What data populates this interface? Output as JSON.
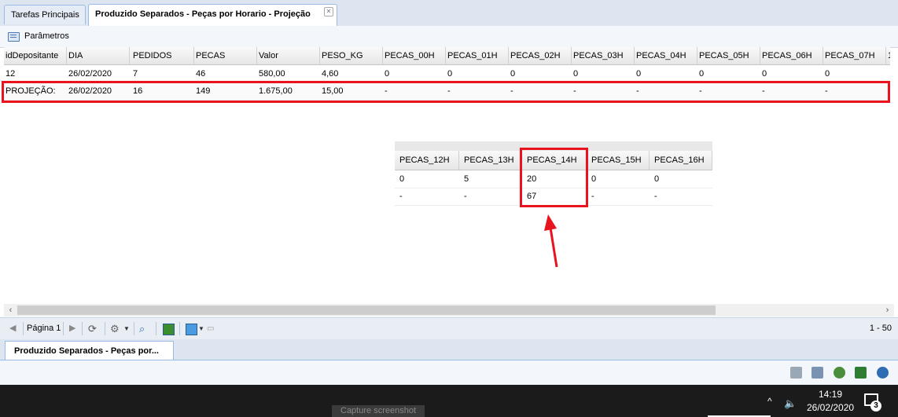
{
  "tabs": {
    "main": "Tarefas Principais",
    "active": "Produzido Separados - Peças por Horario - Projeção",
    "close_glyph": "✕"
  },
  "params": {
    "label": "Parâmetros"
  },
  "grid": {
    "columns": [
      "idDepositante",
      "DIA",
      "PEDIDOS",
      "PECAS",
      "Valor",
      "PESO_KG",
      "PECAS_00H",
      "PECAS_01H",
      "PECAS_02H",
      "PECAS_03H",
      "PECAS_04H",
      "PECAS_05H",
      "PECAS_06H",
      "PECAS_07H",
      "1"
    ],
    "rows": [
      [
        "12",
        "26/02/2020",
        "7",
        "46",
        "580,00",
        "4,60",
        "0",
        "0",
        "0",
        "0",
        "0",
        "0",
        "0",
        "0",
        ""
      ],
      [
        "PROJEÇÃO:",
        "26/02/2020",
        "16",
        "149",
        "1.675,00",
        "15,00",
        "-",
        "-",
        "-",
        "-",
        "-",
        "-",
        "-",
        "-",
        ""
      ]
    ]
  },
  "zoom_table": {
    "columns": [
      "PECAS_12H",
      "PECAS_13H",
      "PECAS_14H",
      "PECAS_15H",
      "PECAS_16H"
    ],
    "rows": [
      [
        "0",
        "5",
        "20",
        "0",
        "0"
      ],
      [
        "-",
        "-",
        "67",
        "-",
        "-"
      ]
    ]
  },
  "scroll": {
    "left": "‹",
    "right": "›"
  },
  "paging": {
    "page_label": "Página 1",
    "count": "1 - 50"
  },
  "task_tab": {
    "label": "Produzido Separados - Peças por..."
  },
  "taskbar": {
    "capture": "Capture screenshot",
    "time": "14:19",
    "date": "26/02/2020",
    "notif_count": "3",
    "chevron": "^",
    "speaker": "🔈"
  },
  "annotation_color": "#e8131d"
}
